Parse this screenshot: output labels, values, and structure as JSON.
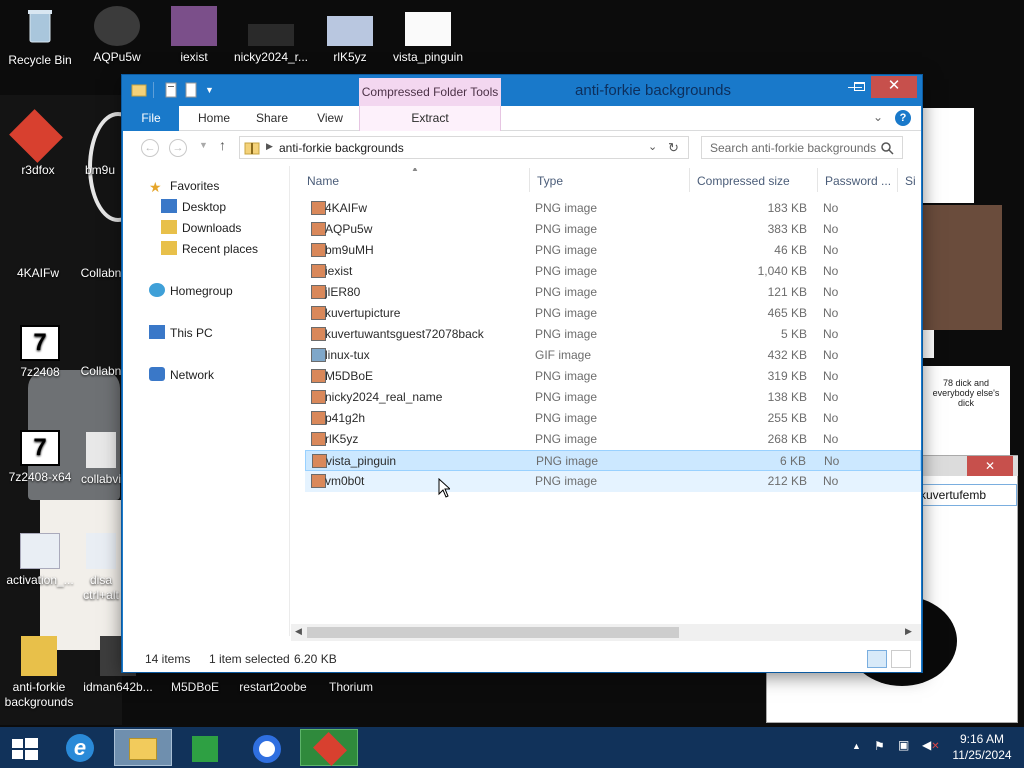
{
  "desktop": {
    "icons": [
      {
        "label": "Recycle Bin"
      },
      {
        "label": "AQPu5w"
      },
      {
        "label": "iexist"
      },
      {
        "label": "nicky2024_r..."
      },
      {
        "label": "rlK5yz"
      },
      {
        "label": "vista_pinguin"
      },
      {
        "label": "r3dfox"
      },
      {
        "label": "bm9u"
      },
      {
        "label": "4KAIFw"
      },
      {
        "label": "Collabn"
      },
      {
        "label": "7z2408"
      },
      {
        "label": "Collabn"
      },
      {
        "label": "7z2408-x64"
      },
      {
        "label": "collabvi"
      },
      {
        "label": "activation_..."
      },
      {
        "label": "disa"
      },
      {
        "label": "ctrl+alt"
      },
      {
        "label": "anti-forkie backgrounds"
      },
      {
        "label": "idman642b..."
      },
      {
        "label": "M5DBoE"
      },
      {
        "label": "restart2oobe"
      },
      {
        "label": "Thorium"
      }
    ],
    "bg_note_text": "78 dick and everybody else's dick",
    "bg_window_text": "kuvertufemb"
  },
  "window": {
    "title": "anti-forkie backgrounds",
    "context_tab": "Compressed Folder Tools",
    "ribbon_tabs": {
      "file": "File",
      "home": "Home",
      "share": "Share",
      "view": "View",
      "extract": "Extract"
    },
    "address": "anti-forkie backgrounds",
    "search_placeholder": "Search anti-forkie backgrounds",
    "nav": {
      "favorites": "Favorites",
      "desktop": "Desktop",
      "downloads": "Downloads",
      "recent": "Recent places",
      "homegroup": "Homegroup",
      "thispc": "This PC",
      "network": "Network"
    },
    "columns": {
      "name": "Name",
      "type": "Type",
      "size": "Compressed size",
      "password": "Password ...",
      "extra": "Si"
    },
    "files": [
      {
        "name": "4KAIFw",
        "type": "PNG image",
        "size": "183 KB",
        "password": "No"
      },
      {
        "name": "AQPu5w",
        "type": "PNG image",
        "size": "383 KB",
        "password": "No"
      },
      {
        "name": "bm9uMH",
        "type": "PNG image",
        "size": "46 KB",
        "password": "No"
      },
      {
        "name": "iexist",
        "type": "PNG image",
        "size": "1,040 KB",
        "password": "No"
      },
      {
        "name": "jlER80",
        "type": "PNG image",
        "size": "121 KB",
        "password": "No"
      },
      {
        "name": "kuvertupicture",
        "type": "PNG image",
        "size": "465 KB",
        "password": "No"
      },
      {
        "name": "kuvertuwantsguest72078back",
        "type": "PNG image",
        "size": "5 KB",
        "password": "No"
      },
      {
        "name": "linux-tux",
        "type": "GIF image",
        "size": "432 KB",
        "password": "No"
      },
      {
        "name": "M5DBoE",
        "type": "PNG image",
        "size": "319 KB",
        "password": "No"
      },
      {
        "name": "nicky2024_real_name",
        "type": "PNG image",
        "size": "138 KB",
        "password": "No"
      },
      {
        "name": "p41g2h",
        "type": "PNG image",
        "size": "255 KB",
        "password": "No"
      },
      {
        "name": "rlK5yz",
        "type": "PNG image",
        "size": "268 KB",
        "password": "No"
      },
      {
        "name": "vista_pinguin",
        "type": "PNG image",
        "size": "6 KB",
        "password": "No"
      },
      {
        "name": "vm0b0t",
        "type": "PNG image",
        "size": "212 KB",
        "password": "No"
      }
    ],
    "status": {
      "count": "14 items",
      "selected": "1 item selected",
      "size": "6.20 KB"
    }
  },
  "taskbar": {
    "time": "9:16 AM",
    "date": "11/25/2024"
  },
  "colors": {
    "titlebar": "#1979ca",
    "taskbar": "#11325a",
    "selection": "#cce8ff",
    "context_tab": "#f3d7f0"
  }
}
